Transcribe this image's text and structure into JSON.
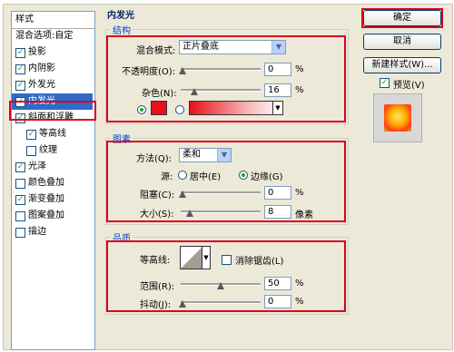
{
  "sidebar": {
    "header": "样式",
    "items": [
      {
        "label": "混合选项:自定",
        "checkbox": false,
        "checked": false
      },
      {
        "label": "投影",
        "checkbox": true,
        "checked": true
      },
      {
        "label": "内阴影",
        "checkbox": true,
        "checked": true
      },
      {
        "label": "外发光",
        "checkbox": true,
        "checked": true
      },
      {
        "label": "内发光",
        "checkbox": true,
        "checked": true,
        "selected": true
      },
      {
        "label": "斜面和浮雕",
        "checkbox": true,
        "checked": true
      },
      {
        "label": "等高线",
        "checkbox": true,
        "checked": true,
        "sub": true
      },
      {
        "label": "纹理",
        "checkbox": true,
        "checked": false,
        "sub": true
      },
      {
        "label": "光泽",
        "checkbox": true,
        "checked": true
      },
      {
        "label": "颜色叠加",
        "checkbox": true,
        "checked": false
      },
      {
        "label": "渐变叠加",
        "checkbox": true,
        "checked": true
      },
      {
        "label": "图案叠加",
        "checkbox": true,
        "checked": false
      },
      {
        "label": "描边",
        "checkbox": true,
        "checked": false
      }
    ]
  },
  "panel": {
    "title": "内发光",
    "structure": {
      "title": "结构",
      "blend_label": "混合模式:",
      "blend_value": "正片叠底",
      "opacity_label": "不透明度(O):",
      "opacity_value": "0",
      "opacity_unit": "%",
      "noise_label": "杂色(N):",
      "noise_value": "16",
      "noise_unit": "%",
      "swatch_color": "#e8101a"
    },
    "elements": {
      "title": "图素",
      "method_label": "方法(Q):",
      "method_value": "柔和",
      "source_label": "源:",
      "center_label": "居中(E)",
      "edge_label": "边缘(G)",
      "choke_label": "阻塞(C):",
      "choke_value": "0",
      "choke_unit": "%",
      "size_label": "大小(S):",
      "size_value": "8",
      "size_unit": "像素"
    },
    "quality": {
      "title": "品质",
      "contour_label": "等高线:",
      "antialias_label": "消除锯齿(L)",
      "range_label": "范围(R):",
      "range_value": "50",
      "range_unit": "%",
      "jitter_label": "抖动(J):",
      "jitter_value": "0",
      "jitter_unit": "%"
    }
  },
  "buttons": {
    "ok": "确定",
    "cancel": "取消",
    "new_style": "新建样式(W)...",
    "preview_label": "预览(V)"
  },
  "colors": {
    "accent_red": "#d9001c",
    "selection": "#316ac5",
    "group_label": "#0046d5"
  }
}
